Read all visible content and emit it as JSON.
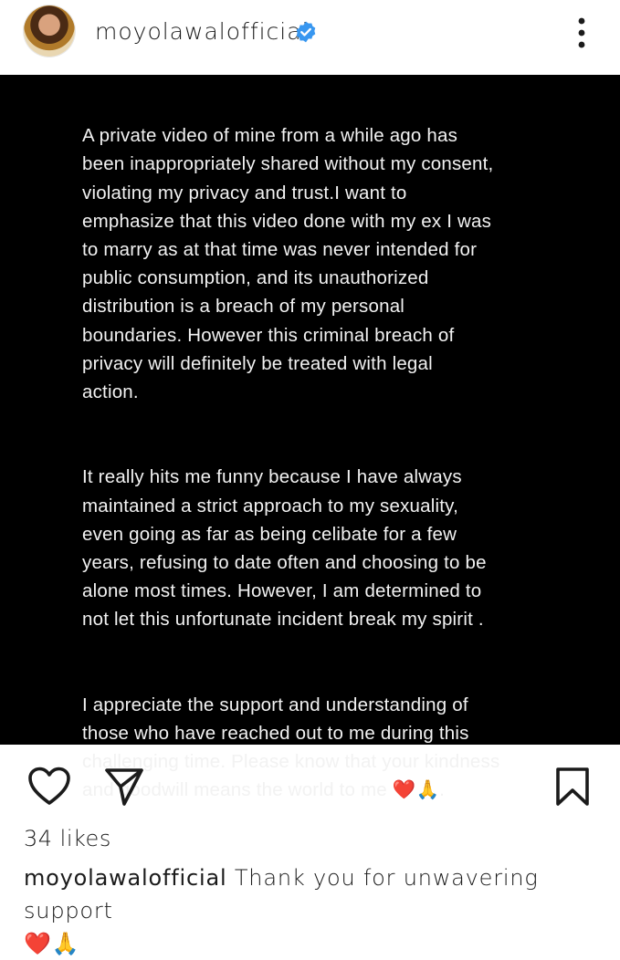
{
  "header": {
    "username": "moyolawalofficial",
    "verified": true
  },
  "post": {
    "paragraphs": [
      "A private video of mine from a while ago has\nbeen inappropriately shared without my consent,\nviolating my privacy and trust.I want to\nemphasize that this video done with my ex I was\nto marry as at that time was never intended for\npublic consumption, and its unauthorized\ndistribution is a breach of my personal\nboundaries. However this criminal breach of\nprivacy will definitely be treated with legal\naction.",
      "  It really hits me funny  because I have always\nmaintained a strict approach to my sexuality,\neven going as far as being celibate for a few\nyears, refusing to date often and choosing to be\nalone most times. However, I am determined to\nnot let this unfortunate incident break my spirit .",
      "  I appreciate the support and understanding of\nthose who have reached out to me during this\nchallenging time. Please know that your kindness\nand goodwill means the world to me ❤️🙏."
    ]
  },
  "actions": {
    "like_icon": "heart-icon",
    "share_icon": "send-icon",
    "save_icon": "bookmark-icon"
  },
  "likes": "34 likes",
  "caption": {
    "username": "moyolawalofficial",
    "text": " Thank you for unwavering support",
    "emoji": "❤️🙏"
  },
  "colors": {
    "post_bg": "#000000",
    "post_text": "#f2f2f2",
    "verified_blue": "#3897f0",
    "heart_red": "#e0245e"
  }
}
